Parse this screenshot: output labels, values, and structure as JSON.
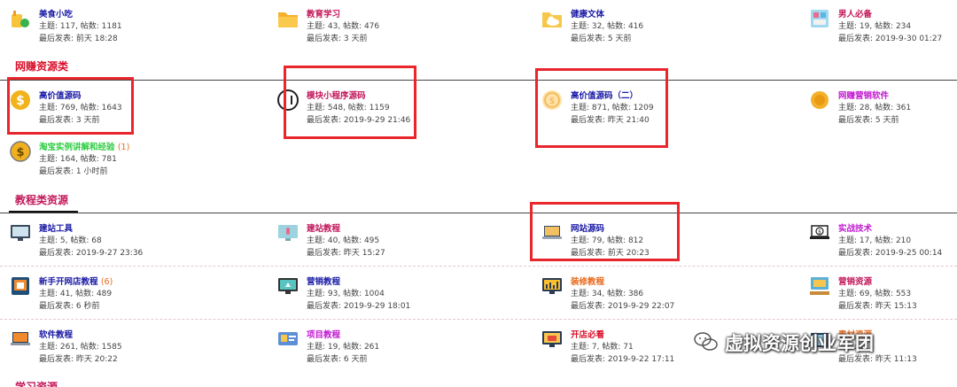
{
  "sections": {
    "top": {
      "forums": [
        {
          "name": "美食小吃",
          "stats": "主题: 117, 帖数: 1181",
          "last": "最后发表: 前天 18:28",
          "name_color": "#1a1aa6",
          "icon": "food-icon"
        },
        {
          "name": "教育学习",
          "stats": "主题: 43, 帖数: 476",
          "last": "最后发表: 3 天前",
          "name_color": "#c2185b",
          "icon": "folder-icon"
        },
        {
          "name": "健康文体",
          "stats": "主题: 32, 帖数: 416",
          "last": "最后发表: 5 天前",
          "name_color": "#1a1aa6",
          "icon": "cloud-icon"
        },
        {
          "name": "男人必备",
          "stats": "主题: 19, 帖数: 234",
          "last": "最后发表: 2019-9-30 01:27",
          "name_color": "#c2185b",
          "icon": "cabinet-icon"
        }
      ]
    },
    "wangzhuan": {
      "title": "网赚资源类",
      "title_color": "#d8102a",
      "forums": [
        {
          "name": "高价值源码",
          "stats": "主题: 769, 帖数: 1643",
          "last": "最后发表: 3 天前",
          "name_color": "#1a1aa6",
          "icon": "gold-coin-icon"
        },
        {
          "name": "模块小程序源码",
          "stats": "主题: 548, 帖数: 1159",
          "last": "最后发表: 2019-9-29 21:46",
          "name_color": "#c2185b",
          "icon": "mini-program-icon"
        },
        {
          "name": "高价值源码（二）",
          "stats": "主题: 871, 帖数: 1209",
          "last": "最后发表: 昨天 21:40",
          "name_color": "#1a1aa6",
          "icon": "coin-outline-icon"
        },
        {
          "name": "网赚营销软件",
          "stats": "主题: 28, 帖数: 361",
          "last": "最后发表: 5 天前",
          "name_color": "#c21ad1",
          "icon": "gold-medal-icon"
        },
        {
          "name": "淘宝实例讲解和经验",
          "new": "(1)",
          "stats": "主题: 164, 帖数: 781",
          "last": "最后发表: 1 小时前",
          "name_color": "#2ecc40",
          "icon": "dollar-coin-icon"
        }
      ]
    },
    "jiaocheng": {
      "title": "教程类资源",
      "title_color": "#c2185b",
      "forums": [
        {
          "name": "建站工具",
          "stats": "主题: 5, 帖数: 68",
          "last": "最后发表: 2019-9-27 23:36",
          "name_color": "#1a1aa6",
          "icon": "monitor-icon"
        },
        {
          "name": "建站教程",
          "stats": "主题: 40, 帖数: 495",
          "last": "最后发表: 昨天 15:27",
          "name_color": "#c2185b",
          "icon": "monitor-mic-icon"
        },
        {
          "name": "网站源码",
          "stats": "主题: 79, 帖数: 812",
          "last": "最后发表: 前天 20:23",
          "name_color": "#1a1aa6",
          "icon": "laptop-icon"
        },
        {
          "name": "实战技术",
          "stats": "主题: 17, 帖数: 210",
          "last": "最后发表: 2019-9-25 00:14",
          "name_color": "#c21ad1",
          "icon": "laptop-dollar-icon"
        },
        {
          "name": "新手开网店教程",
          "new": "(6)",
          "stats": "主题: 41, 帖数: 489",
          "last": "最后发表: 6 秒前",
          "name_color": "#1a1aa6",
          "icon": "tablet-shop-icon"
        },
        {
          "name": "营销教程",
          "stats": "主题: 93, 帖数: 1004",
          "last": "最后发表: 2019-9-29 18:01",
          "name_color": "#1a1aa6",
          "icon": "recycle-monitor-icon"
        },
        {
          "name": "装修教程",
          "stats": "主题: 34, 帖数: 386",
          "last": "最后发表: 2019-9-29 22:07",
          "name_color": "#e86a1d",
          "icon": "chart-monitor-icon"
        },
        {
          "name": "营销资源",
          "stats": "主题: 69, 帖数: 553",
          "last": "最后发表: 昨天 15:13",
          "name_color": "#c2185b",
          "icon": "desk-monitor-icon"
        },
        {
          "name": "软件教程",
          "stats": "主题: 261, 帖数: 1585",
          "last": "最后发表: 昨天 20:22",
          "name_color": "#1a1aa6",
          "icon": "laptop-orange-icon"
        },
        {
          "name": "项目教程",
          "stats": "主题: 19, 帖数: 261",
          "last": "最后发表: 6 天前",
          "name_color": "#c21ad1",
          "icon": "card-icon"
        },
        {
          "name": "开店必看",
          "stats": "主题: 7, 帖数: 71",
          "last": "最后发表: 2019-9-22 17:11",
          "name_color": "#d8102a",
          "icon": "shop-monitor-icon"
        },
        {
          "name": "素材资源",
          "stats": "主题: 2",
          "last": "最后发表: 昨天 11:13",
          "name_color": "#e86a1d",
          "icon": "box-icon"
        }
      ]
    },
    "xuexi": {
      "title": "学习资源",
      "title_color": "#c2185b"
    }
  },
  "watermark": "虚拟资源创业军团"
}
